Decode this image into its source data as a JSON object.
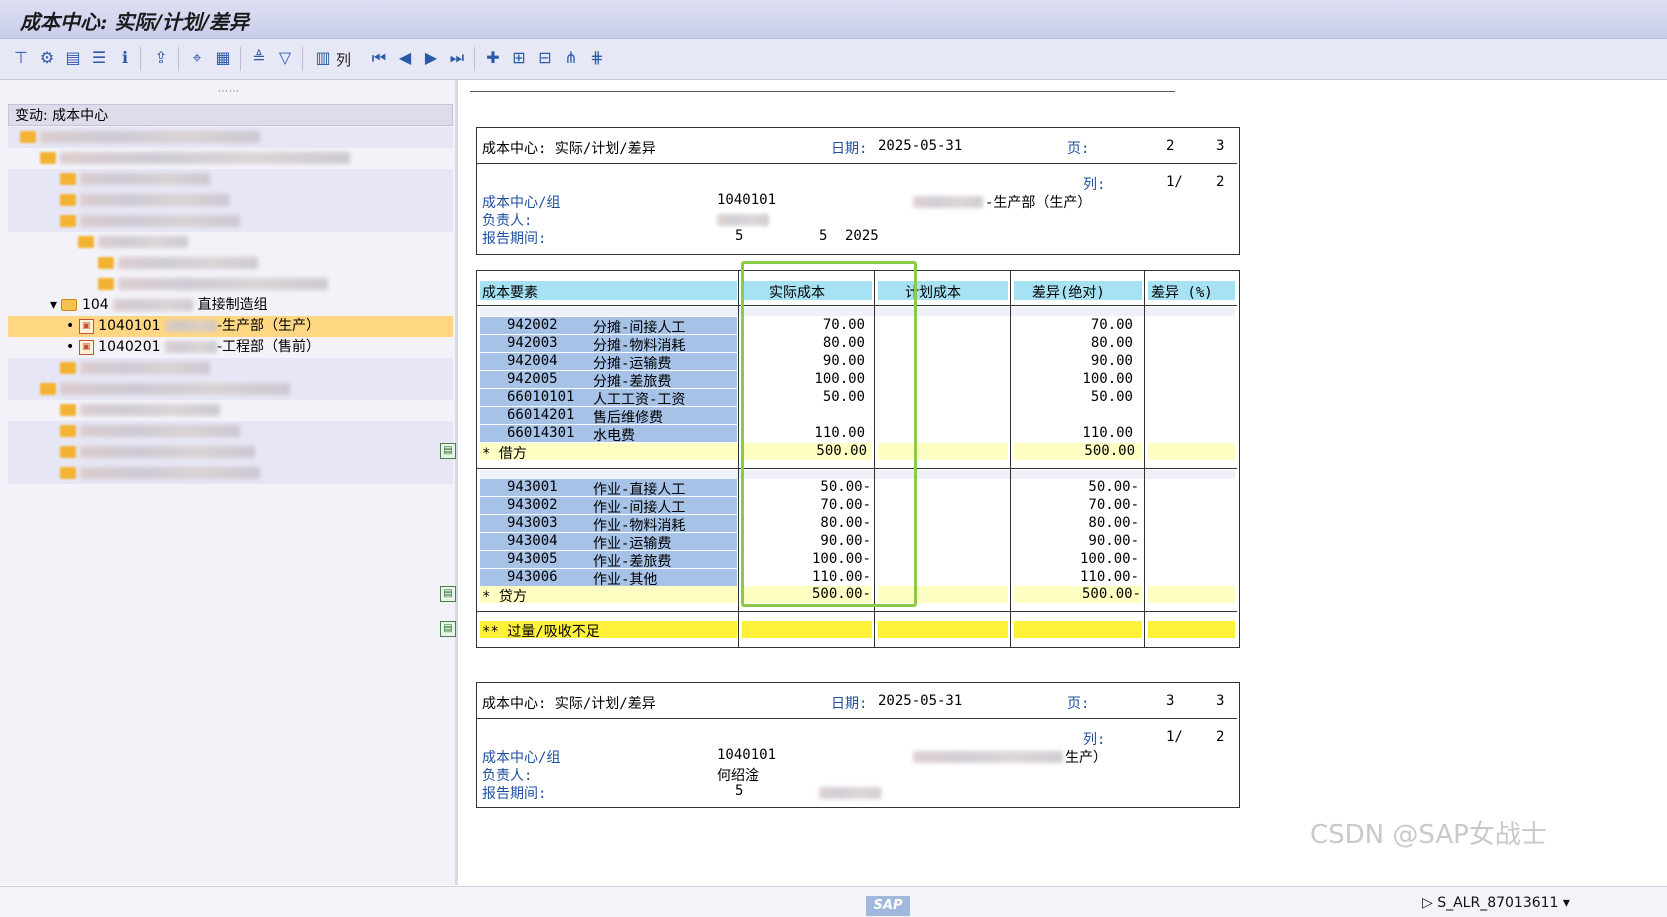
{
  "window": {
    "title": "成本中心: 实际/计划/差异"
  },
  "toolbar": {
    "columns_label": "列"
  },
  "tree": {
    "header": "变动: 成本中心",
    "group_label": "104",
    "group_name": "直接制造组",
    "node1_code": "1040101",
    "node1_name": "-生产部（生产）",
    "node2_code": "1040201",
    "node2_name": "-工程部（售前）"
  },
  "report1": {
    "title": "成本中心: 实际/计划/差异",
    "date_label": "日期:",
    "date": "2025-05-31",
    "page_label": "页:",
    "page": "2",
    "pages": "3",
    "col_label": "列:",
    "col": "1/",
    "cols": "2",
    "cc_label": "成本中心/组",
    "cc_code": "1040101",
    "cc_name": "-生产部（生产）",
    "owner_label": "负责人:",
    "period_label": "报告期间:",
    "period_from": "5",
    "period_to": "5",
    "year": "2025"
  },
  "table": {
    "headers": {
      "element": "成本要素",
      "actual": "实际成本",
      "plan": "计划成本",
      "diff_abs": "差异(绝对)",
      "diff_pct": "差异 (%)"
    },
    "debit_rows": [
      {
        "code": "942002",
        "name": "分摊-间接人工",
        "actual": "70.00",
        "diff": "70.00"
      },
      {
        "code": "942003",
        "name": "分摊-物料消耗",
        "actual": "80.00",
        "diff": "80.00"
      },
      {
        "code": "942004",
        "name": "分摊-运输费",
        "actual": "90.00",
        "diff": "90.00"
      },
      {
        "code": "942005",
        "name": "分摊-差旅费",
        "actual": "100.00",
        "diff": "100.00"
      },
      {
        "code": "66010101",
        "name": "人工工资-工资",
        "actual": "50.00",
        "diff": "50.00"
      },
      {
        "code": "66014201",
        "name": "售后维修费",
        "actual": "",
        "diff": ""
      },
      {
        "code": "66014301",
        "name": "水电费",
        "actual": "110.00",
        "diff": "110.00"
      }
    ],
    "debit_total": {
      "label": "*  借方",
      "actual": "500.00",
      "diff": "500.00"
    },
    "credit_rows": [
      {
        "code": "943001",
        "name": "作业-直接人工",
        "actual": "50.00-",
        "diff": "50.00-"
      },
      {
        "code": "943002",
        "name": "作业-间接人工",
        "actual": "70.00-",
        "diff": "70.00-"
      },
      {
        "code": "943003",
        "name": "作业-物料消耗",
        "actual": "80.00-",
        "diff": "80.00-"
      },
      {
        "code": "943004",
        "name": "作业-运输费",
        "actual": "90.00-",
        "diff": "90.00-"
      },
      {
        "code": "943005",
        "name": "作业-差旅费",
        "actual": "100.00-",
        "diff": "100.00-"
      },
      {
        "code": "943006",
        "name": "作业-其他",
        "actual": "110.00-",
        "diff": "110.00-"
      }
    ],
    "credit_total": {
      "label": "*  贷方",
      "actual": "500.00-",
      "diff": "500.00-"
    },
    "grand_total": {
      "label": "** 过量/吸收不足"
    }
  },
  "report2": {
    "title": "成本中心: 实际/计划/差异",
    "date_label": "日期:",
    "date": "2025-05-31",
    "page_label": "页:",
    "page": "3",
    "pages": "3",
    "col_label": "列:",
    "col": "1/",
    "cols": "2",
    "cc_label": "成本中心/组",
    "cc_code": "1040101",
    "cc_name_tail": "生产）",
    "owner_label": "负责人:",
    "owner": "何绍淦",
    "period_label": "报告期间:",
    "period_from": "5"
  },
  "status": {
    "logo": "SAP",
    "text": "S_ALR_87013611"
  },
  "watermark": "CSDN @SAP女战士",
  "colors": {
    "selection": "#ffd782",
    "row_blue": "#a6c2e6",
    "header_cyan": "#a7e2f4",
    "total_yellow": "#fff13a",
    "highlight_frame": "#8ccb47"
  }
}
